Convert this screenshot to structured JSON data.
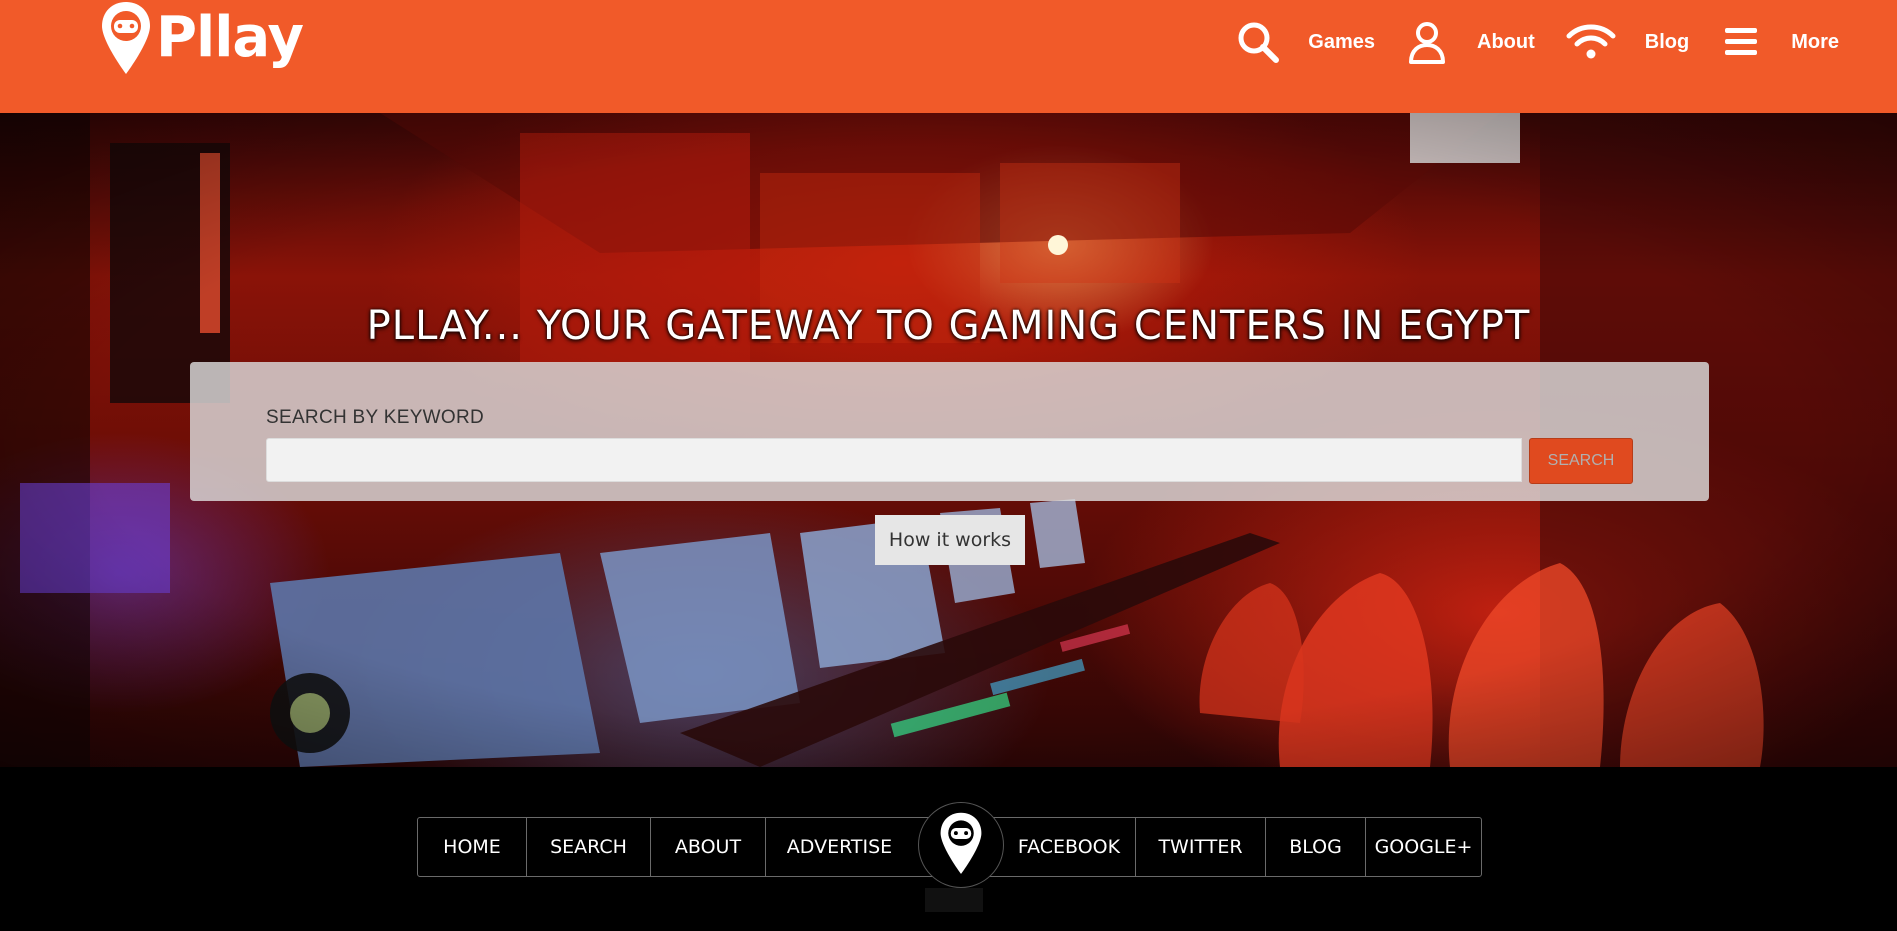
{
  "brand": {
    "name": "Pllay"
  },
  "nav": [
    {
      "label": "Games",
      "icon": "search-icon"
    },
    {
      "label": "About",
      "icon": "user-icon"
    },
    {
      "label": "Blog",
      "icon": "wifi-icon"
    },
    {
      "label": "More",
      "icon": "menu-icon"
    }
  ],
  "hero": {
    "title": "PLLAY... YOUR GATEWAY TO GAMING CENTERS IN EGYPT",
    "search_label": "SEARCH BY KEYWORD",
    "search_value": "",
    "search_button": "SEARCH",
    "how_it_works": "How it works"
  },
  "footer": {
    "links_left": [
      "HOME",
      "SEARCH",
      "ABOUT",
      "ADVERTISE"
    ],
    "links_right": [
      "FACEBOOK",
      "TWITTER",
      "BLOG",
      "GOOGLE+"
    ]
  },
  "colors": {
    "brand_orange": "#f15a29",
    "search_button": "#e04a1f",
    "footer_bg": "#000000"
  }
}
